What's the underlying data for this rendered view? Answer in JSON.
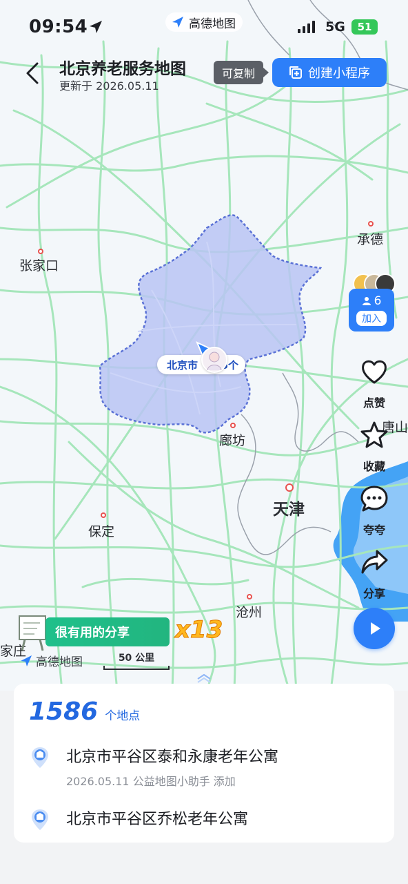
{
  "status_bar": {
    "time": "09:54",
    "app_brand": "高德地图",
    "network": "5G",
    "battery": "51"
  },
  "header": {
    "title": "北京养老服务地图",
    "subtitle": "更新于 2026.05.11",
    "copy_tip": "可复制",
    "create_button": "创建小程序"
  },
  "map": {
    "cities": {
      "zhangjiakou": "张家口",
      "chengde": "承德",
      "langfang": "廊坊",
      "tianjin": "天津",
      "baoding": "保定",
      "cangzhou": "沧州",
      "tangshan": "唐山",
      "jiazhuang": "家庄"
    },
    "beijing_label": "北京市",
    "beijing_count": "5个",
    "logo_text": "高德地图",
    "scale_label": "50 公里"
  },
  "side_actions": {
    "member_count": "6",
    "join": "加入",
    "like": "点赞",
    "favorite": "收藏",
    "comment": "夸夸",
    "share": "分享"
  },
  "banner": {
    "text": "很有用的分享",
    "multiplier": "x13"
  },
  "list": {
    "total": "1586",
    "unit": "个地点",
    "items": [
      {
        "name": "北京市平谷区泰和永康老年公寓",
        "meta": "2026.05.11 公益地图小助手 添加"
      },
      {
        "name": "北京市平谷区乔松老年公寓"
      }
    ]
  },
  "colors": {
    "accent": "#2d7ff9",
    "region_fill": "#b9c4f3",
    "region_border": "#5b72d6",
    "road": "#9fe3b4",
    "banner_green": "#1fc08b",
    "multiplier": "#ffb81f"
  }
}
